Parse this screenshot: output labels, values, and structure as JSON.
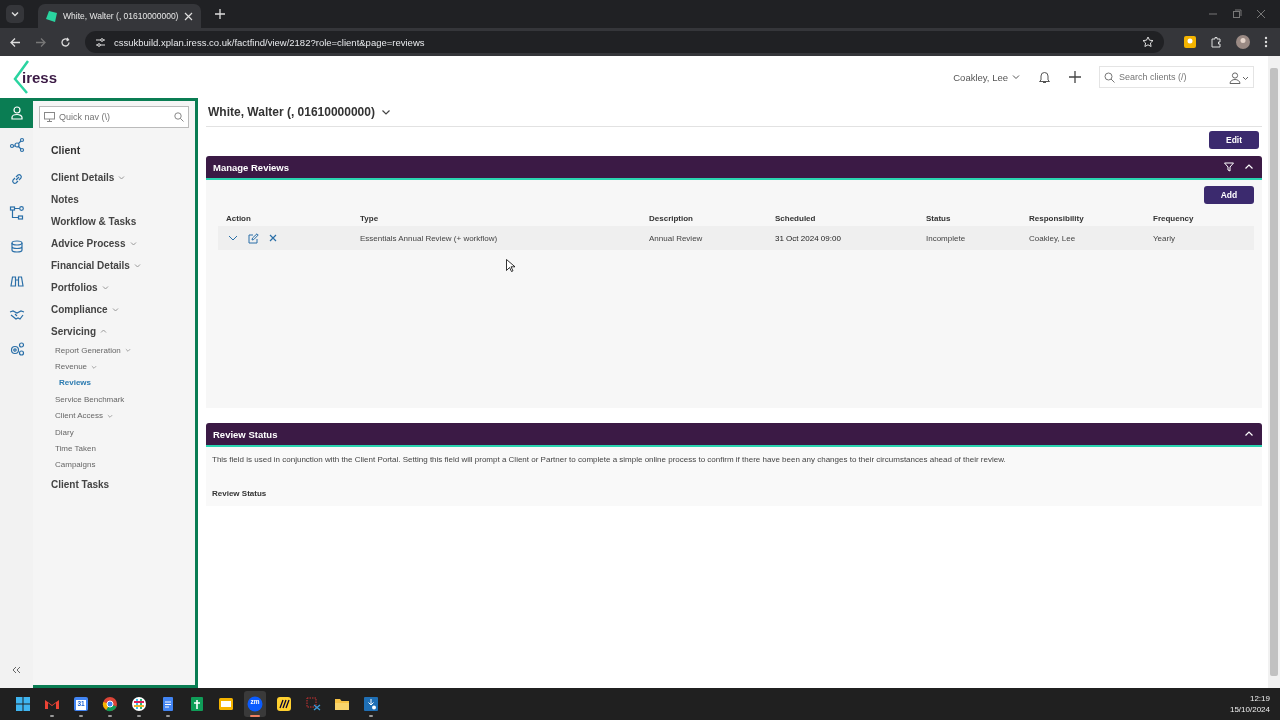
{
  "browser": {
    "tab_title": "White, Walter (, 01610000000)",
    "url": "cssukbuild.xplan.iress.co.uk/factfind/view/2182?role=client&page=reviews"
  },
  "header": {
    "logo": "iress",
    "user": "Coakley, Lee",
    "search_placeholder": "Search clients (/)"
  },
  "rail": [
    {
      "kind": "person",
      "selected": true
    },
    {
      "kind": "network",
      "selected": false
    },
    {
      "kind": "link",
      "selected": false
    },
    {
      "kind": "flow",
      "selected": false
    },
    {
      "kind": "coins",
      "selected": false
    },
    {
      "kind": "binoculars",
      "selected": false
    },
    {
      "kind": "handshake",
      "selected": false
    },
    {
      "kind": "gears",
      "selected": false
    }
  ],
  "nav": {
    "quick_nav_placeholder": "Quick nav (\\)",
    "heading": "Client",
    "items": [
      {
        "label": "Client Details",
        "expanded": false,
        "selected": false
      },
      {
        "label": "Notes",
        "selected": false
      },
      {
        "label": "Workflow & Tasks",
        "selected": false
      },
      {
        "label": "Advice Process",
        "expanded": false,
        "selected": false
      },
      {
        "label": "Financial Details",
        "expanded": false,
        "selected": false
      },
      {
        "label": "Portfolios",
        "expanded": false,
        "selected": false
      },
      {
        "label": "Compliance",
        "expanded": false,
        "selected": false
      },
      {
        "label": "Servicing",
        "expanded": true,
        "selected": false,
        "children": [
          {
            "label": "Report Generation",
            "expanded": false,
            "selected": false
          },
          {
            "label": "Revenue",
            "expanded": false,
            "selected": false
          },
          {
            "label": "Reviews",
            "selected": true
          },
          {
            "label": "Service Benchmark",
            "selected": false
          },
          {
            "label": "Client Access",
            "expanded": false,
            "selected": false
          },
          {
            "label": "Diary",
            "selected": false
          },
          {
            "label": "Time Taken",
            "selected": false
          },
          {
            "label": "Campaigns",
            "selected": false
          }
        ]
      },
      {
        "label": "Client Tasks",
        "selected": false
      }
    ]
  },
  "client": {
    "name": "White, Walter (, 01610000000)",
    "edit_button": "Edit"
  },
  "manage_reviews": {
    "title": "Manage Reviews",
    "expanded": true,
    "add_button": "Add",
    "columns": [
      "Action",
      "Type",
      "Description",
      "Scheduled",
      "Status",
      "Responsibility",
      "Frequency"
    ],
    "rows": [
      {
        "type": "Essentials Annual Review (+ workflow)",
        "description": "Annual Review",
        "scheduled": "31 Oct 2024 09:00",
        "status": "Incomplete",
        "responsibility": "Coakley, Lee",
        "frequency": "Yearly"
      }
    ]
  },
  "review_status": {
    "title": "Review Status",
    "expanded": true,
    "description": "This field is used in conjunction with the Client Portal. Setting this field will prompt a Client or Partner to complete a simple online process to confirm if there have been any changes to their circumstances ahead of their review.",
    "field_label": "Review Status"
  },
  "taskbar": {
    "apps": [
      {
        "kind": "windows",
        "running": false,
        "active": false
      },
      {
        "kind": "mail",
        "running": true,
        "active": false
      },
      {
        "kind": "calendar",
        "label": "31",
        "running": true,
        "active": false
      },
      {
        "kind": "browser",
        "running": true,
        "active": false
      },
      {
        "kind": "chat",
        "running": true,
        "active": false
      },
      {
        "kind": "docs",
        "running": true,
        "active": false
      },
      {
        "kind": "sheets",
        "running": false,
        "active": false
      },
      {
        "kind": "slides",
        "running": false,
        "active": false
      },
      {
        "kind": "meeting",
        "label": "zm",
        "running": true,
        "active": true
      },
      {
        "kind": "board",
        "running": false,
        "active": false
      },
      {
        "kind": "snip",
        "running": false,
        "active": false
      },
      {
        "kind": "folder",
        "running": false,
        "active": false
      },
      {
        "kind": "installer",
        "running": true,
        "active": false
      }
    ],
    "time": "12:19",
    "date": "15/10/2024"
  }
}
